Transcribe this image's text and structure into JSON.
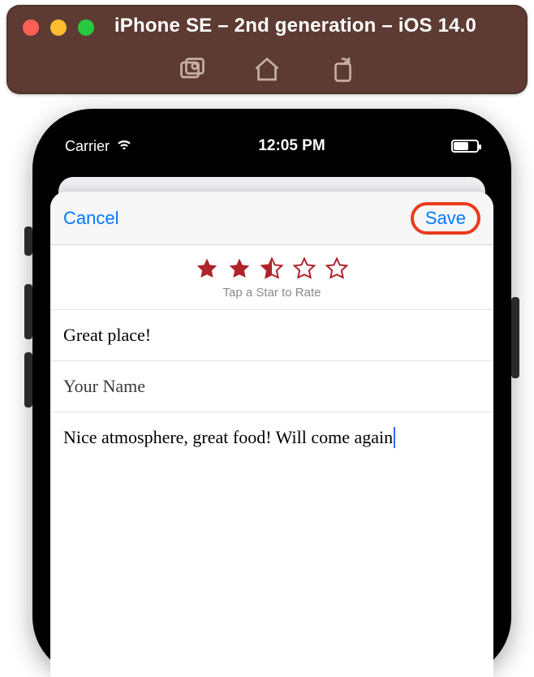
{
  "simulator": {
    "title": "iPhone SE – 2nd generation – iOS 14.0"
  },
  "status": {
    "carrier": "Carrier",
    "time": "12:05 PM"
  },
  "modal": {
    "cancel_label": "Cancel",
    "save_label": "Save",
    "rating": 2.5,
    "rating_hint": "Tap a Star to Rate",
    "title_field": {
      "value": "Great place!"
    },
    "name_field": {
      "placeholder": "Your Name"
    },
    "body_field": {
      "value": "Nice atmosphere, great food! Will come again"
    }
  },
  "colors": {
    "ios_blue": "#007aff",
    "highlight_ring": "#eb3b1c",
    "star_fill": "#b0232a"
  }
}
